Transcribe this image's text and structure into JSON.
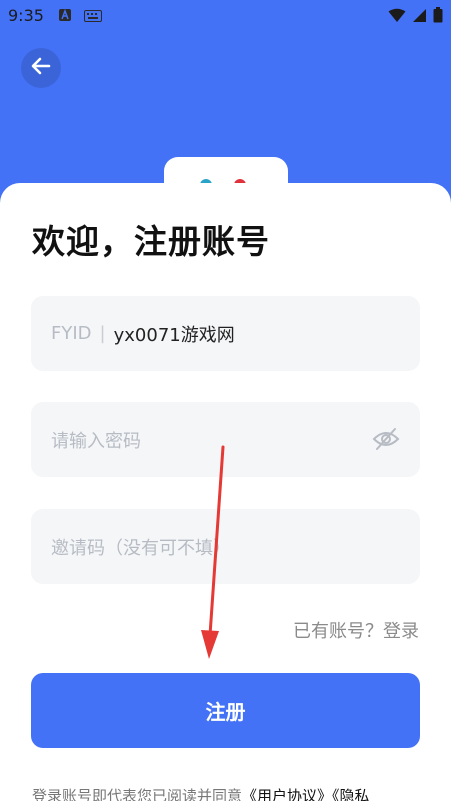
{
  "status_bar": {
    "time": "9:35"
  },
  "header": {
    "back_icon": "arrow-left-icon"
  },
  "title": "欢迎，注册账号",
  "form": {
    "id_field": {
      "prefix": "FYID",
      "separator": "|",
      "value": "yx0071游戏网"
    },
    "password_field": {
      "placeholder": "请输入密码",
      "icon": "eye-off-icon"
    },
    "invite_field": {
      "placeholder": "邀请码（没有可不填）"
    }
  },
  "login_link": "已有账号？登录",
  "register_button": "注册",
  "agreement": {
    "text": "登录账号即代表您已阅读并同意",
    "link1": "《用户协议》",
    "link2": "《隐私"
  },
  "colors": {
    "primary": "#4472f6",
    "annotation_arrow": "#e53935"
  }
}
